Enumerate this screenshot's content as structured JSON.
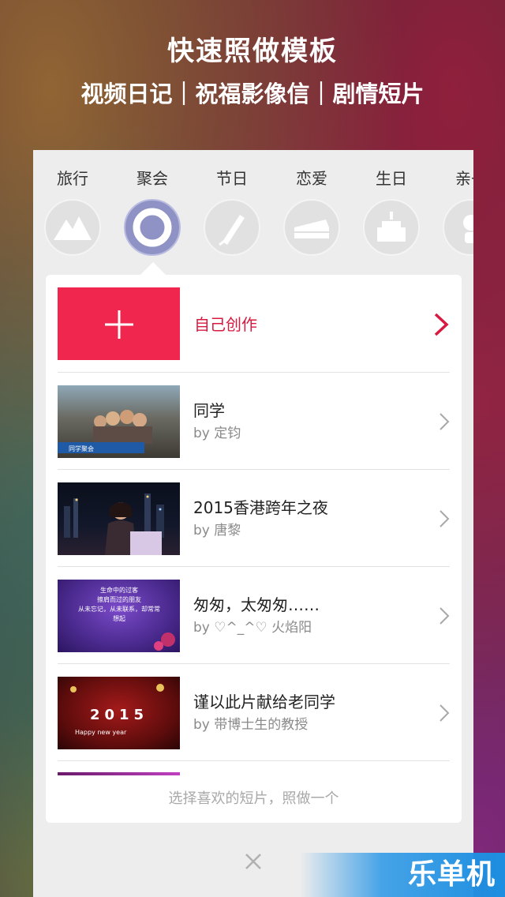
{
  "header": {
    "title": "快速照做模板",
    "subtitle": "视频日记｜祝福影像信｜剧情短片"
  },
  "categories": [
    {
      "label": "旅行",
      "icon": "mountain-icon"
    },
    {
      "label": "聚会",
      "icon": "lifebuoy-icon",
      "active": true
    },
    {
      "label": "节日",
      "icon": "firework-icon"
    },
    {
      "label": "恋爱",
      "icon": "cake-slice-icon"
    },
    {
      "label": "生日",
      "icon": "birthday-cake-icon"
    },
    {
      "label": "亲子",
      "icon": "baby-icon"
    }
  ],
  "create": {
    "label": "自己创作"
  },
  "templates": [
    {
      "title": "同学",
      "author": "by 定钧",
      "thumb_caption": "同学聚会"
    },
    {
      "title": "2015香港跨年之夜",
      "author": "by 唐黎"
    },
    {
      "title": "匆匆，太匆匆……",
      "author": "by ♡^_^♡ 火焰阳",
      "thumb_text": [
        "生命中的过客",
        "擦肩而过的朋友",
        "从未忘记，从未联系，却常常",
        "想起"
      ]
    },
    {
      "title": "谨以此片献给老同学",
      "author": "by 带博士生的教授",
      "thumb_text": [
        "2015",
        "Happy new year"
      ]
    }
  ],
  "footer_hint": "选择喜欢的短片，照做一个",
  "watermark": "乐单机",
  "colors": {
    "accent": "#f0264f",
    "active_category": "#8e92c4"
  }
}
